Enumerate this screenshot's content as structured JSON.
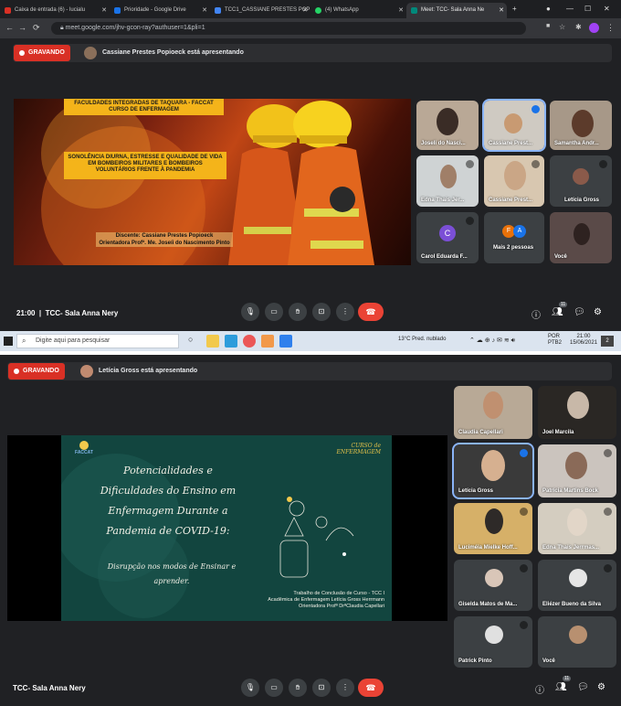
{
  "screen1": {
    "tabs": [
      {
        "label": "Caixa de entrada (6) - lucialu",
        "color": "#d93025"
      },
      {
        "label": "Prioridade - Google Drive",
        "color": "#1a73e8"
      },
      {
        "label": "TCC1_CASSIANE PRESTES POP",
        "color": "#4285f4"
      },
      {
        "label": "(4) WhatsApp",
        "color": "#25d366"
      },
      {
        "label": "Meet: TCC- Sala Anna Ne",
        "color": "#00897b"
      }
    ],
    "url": "meet.google.com/jhv-gcon-ray?authuser=1&pli=1",
    "recording_label": "GRAVANDO",
    "presenter_text": "Cassiane Prestes Popioeck está apresentando",
    "slide": {
      "header1": "FACULDADES INTEGRADAS DE TAQUARA - FACCAT",
      "header2": "CURSO DE ENFERMAGEM",
      "title": "SONOLÊNCIA DIURNA, ESTRESSE E QUALIDADE DE VIDA EM BOMBEIROS MILITARES E BOMBEIROS VOLUNTÁRIOS FRENTE À PANDEMIA",
      "student": "Discente: Cassiane Prestes Popioeck",
      "advisor": "Orientadora Profª. Me. Joseíi do Nascimento Pinto"
    },
    "participants": [
      {
        "name": "Joseli do Nasci...",
        "bg": "#b9a896",
        "face": "#3a2c26"
      },
      {
        "name": "Cassiane Prest...",
        "bg": "#cfcac2",
        "face": "#c89a72"
      },
      {
        "name": "Samantha Andr...",
        "bg": "#a79888",
        "face": "#5c3b2b"
      },
      {
        "name": "Edna Thais Jer...",
        "bg": "#cfd3d4",
        "face": "#a07f68"
      },
      {
        "name": "Cassiane Prest...",
        "bg": "#d8c7b0",
        "face": "#caa686"
      },
      {
        "name": "Letícia Gross",
        "bg": "#3c4043",
        "face": "#8a5a4a"
      },
      {
        "name": "Carol Eduarda F...",
        "letter": "C",
        "bg": "#3c4043",
        "face": "#7b4fd6"
      },
      {
        "name": "Mais 2 pessoas",
        "bg": "#3c4043"
      },
      {
        "name": "Você",
        "bg": "#5a4a48",
        "face": "#2e2220"
      }
    ],
    "more_letters": [
      "F",
      "A"
    ],
    "time": "21:00",
    "meeting_name": "TCC- Sala Anna Nery",
    "participant_count": "11",
    "taskbar": {
      "search_placeholder": "Digite aqui para pesquisar",
      "weather": "13°C  Pred. nublado",
      "lang1": "POR",
      "lang2": "PTB2",
      "clock_time": "21:00",
      "clock_date": "15/06/2021",
      "notifications": "2"
    }
  },
  "screen2": {
    "recording_label": "GRAVANDO",
    "presenter_text": "Letícia Gross está apresentando",
    "slide": {
      "logo_left": "FACCAT",
      "logo_right_top": "CURSO de",
      "logo_right_bottom": "ENFERMAGEM",
      "title_lines": [
        "Potencialidades e",
        "Dificuldades do Ensino em",
        "Enfermagem Durante a",
        "Pandemia de COVID-19:"
      ],
      "subtitle_lines": [
        "Disrupção nos modos de Ensinar e",
        "aprender."
      ],
      "footer_lines": [
        "Trabalho de Conclusão de Curso - TCC I",
        "Acadêmica de Enfermagem Letícia Gross Herrmann",
        "Orientadora Profª DrªClaudia Capellari"
      ]
    },
    "participants": [
      {
        "name": "Claudia Capellari",
        "bg": "#b8a996",
        "face": "#c09070"
      },
      {
        "name": "Joel Marcila",
        "bg": "#2a2724",
        "face": "#c8b8a8"
      },
      {
        "name": "Letícia Gross",
        "bg": "#3a3a3a",
        "face": "#d6b090"
      },
      {
        "name": "Patrícia Martins Bock",
        "bg": "#cbc4be",
        "face": "#8a6a58"
      },
      {
        "name": "Luciméia Mielke Hoff...",
        "bg": "#d6b068",
        "face": "#2e2a28"
      },
      {
        "name": "Edna Thais Jerrmas...",
        "bg": "#d4cdc0",
        "face": "#e2d6c8"
      },
      {
        "name": "Giselda Matos de Ma...",
        "bg": "#3c4043",
        "face": "#d9c6b8"
      },
      {
        "name": "Eliézer Bueno da Silva",
        "bg": "#3c4043",
        "face": "#e6e6e6"
      },
      {
        "name": "Patrick Pinto",
        "bg": "#3c4043",
        "face": "#e0e0e0"
      },
      {
        "name": "Você",
        "bg": "#3c4043",
        "face": "#b89070"
      }
    ],
    "meeting_name": "TCC- Sala Anna Nery",
    "participant_count": "11"
  },
  "colors": {
    "meet_bg": "#202124",
    "record_red": "#d93025",
    "end_call_red": "#ea4335",
    "speaking_blue": "#8ab4f8",
    "slide_yellow": "#f4b41a",
    "chalkboard_green": "#12453f"
  },
  "icons": [
    "mic-icon",
    "camera-icon",
    "raise-hand-icon",
    "present-icon",
    "more-icon",
    "end-call-icon",
    "info-icon",
    "people-icon",
    "chat-icon",
    "activities-icon"
  ]
}
